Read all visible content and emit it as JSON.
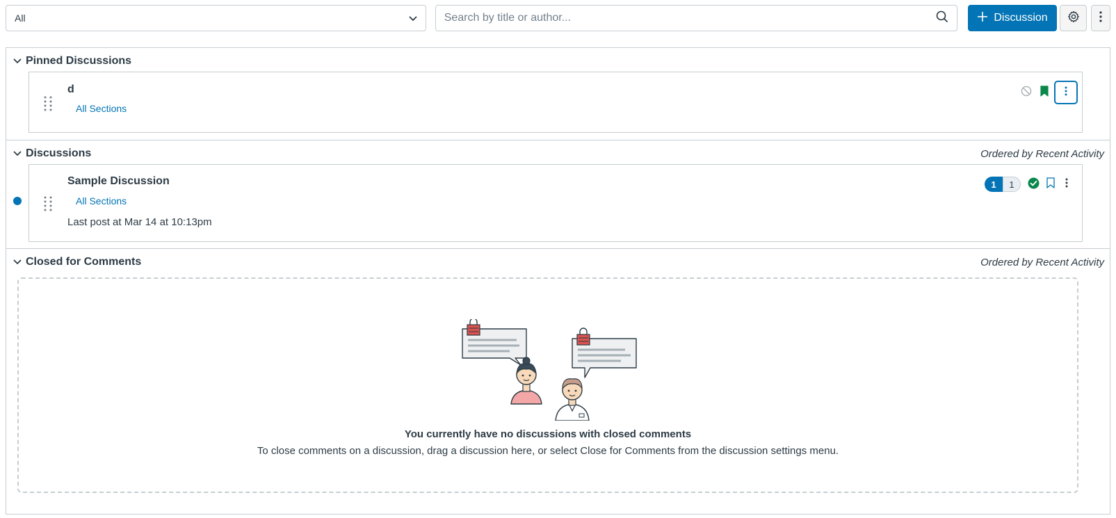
{
  "toolbar": {
    "filter_value": "All",
    "search_placeholder": "Search by title or author...",
    "add_discussion_label": "Discussion"
  },
  "pinned": {
    "title": "Pinned Discussions",
    "items": [
      {
        "title": "d",
        "sections": "All Sections"
      }
    ]
  },
  "discussions": {
    "title": "Discussions",
    "ordered_label": "Ordered by Recent Activity",
    "items": [
      {
        "title": "Sample Discussion",
        "sections": "All Sections",
        "last_post": "Last post at Mar 14 at 10:13pm",
        "unread_count": "1",
        "total_count": "1"
      }
    ]
  },
  "closed": {
    "title": "Closed for Comments",
    "ordered_label": "Ordered by Recent Activity",
    "empty_title": "You currently have no discussions with closed comments",
    "empty_description": "To close comments on a discussion, drag a discussion here, or select Close for Comments from the discussion settings menu."
  },
  "colors": {
    "accent": "#0374b5",
    "published": "#0b874b",
    "border": "#c7cdd1",
    "text": "#2d3b45"
  },
  "icons": [
    "chevron-down-icon",
    "search-icon",
    "plus-icon",
    "gear-icon",
    "kebab-icon",
    "drag-handle-icon",
    "unpublished-icon",
    "bookmark-filled-icon",
    "bookmark-outline-icon",
    "published-check-icon"
  ]
}
